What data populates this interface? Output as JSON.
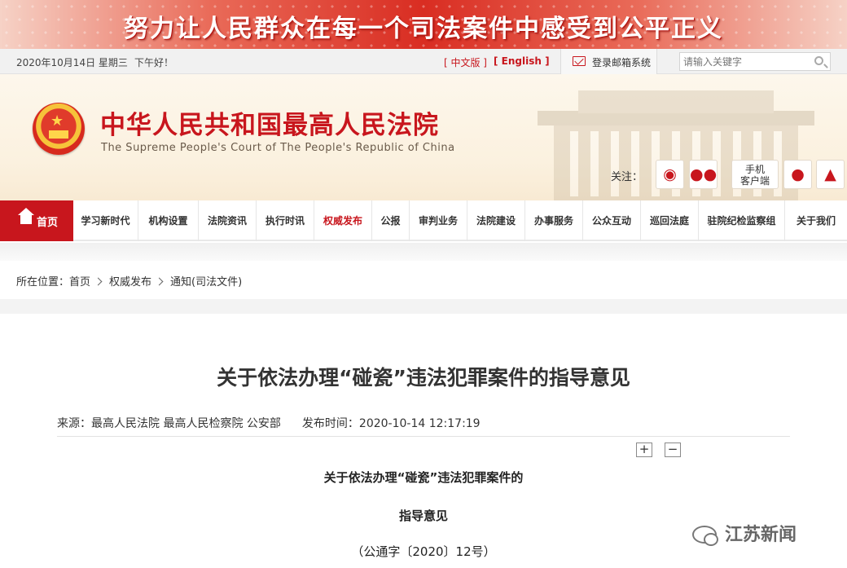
{
  "banner": {
    "slogan": "努力让人民群众在每一个司法案件中感受到公平正义"
  },
  "util": {
    "date": "2020年10月14日 星期三",
    "greeting": "下午好！",
    "lang_cn": "[ 中文版 ]",
    "lang_en": "[ English ]",
    "mailbox": "登录邮箱系统",
    "search_placeholder": "请输入关键字"
  },
  "header": {
    "title": "中华人民共和国最高人民法院",
    "subtitle": "The Supreme People's Court of The People's Republic of China",
    "follow_label": "关注：",
    "mobile_line1": "手机",
    "mobile_line2": "客户端",
    "icons": [
      "weibo-icon",
      "wechat-icon",
      "apple-icon",
      "android-icon"
    ]
  },
  "nav": {
    "home": "首页",
    "items": [
      "学习新时代",
      "机构设置",
      "法院资讯",
      "执行时讯",
      "权威发布",
      "公报",
      "审判业务",
      "法院建设",
      "办事服务",
      "公众互动",
      "巡回法庭",
      "驻院纪检监察组",
      "关于我们"
    ],
    "active_index": 4
  },
  "breadcrumb": {
    "label": "所在位置：",
    "items": [
      "首页",
      "权威发布",
      "通知(司法文件)"
    ]
  },
  "article": {
    "title": "关于依法办理“碰瓷”违法犯罪案件的指导意见",
    "source": "来源：最高人民法院 最高人民检察院 公安部",
    "published": "发布时间：2020-10-14 12:17:19",
    "zoom_in": "+",
    "zoom_out": "−",
    "doc_heading_1": "关于依法办理“碰瓷”违法犯罪案件的",
    "doc_heading_2": "指导意见",
    "doc_number": "（公通字〔2020〕12号）"
  },
  "watermark": "江苏新闻",
  "colors": {
    "accent": "#c8161d",
    "banner_red": "#d92d22",
    "header_bg": "#fbf1df"
  }
}
